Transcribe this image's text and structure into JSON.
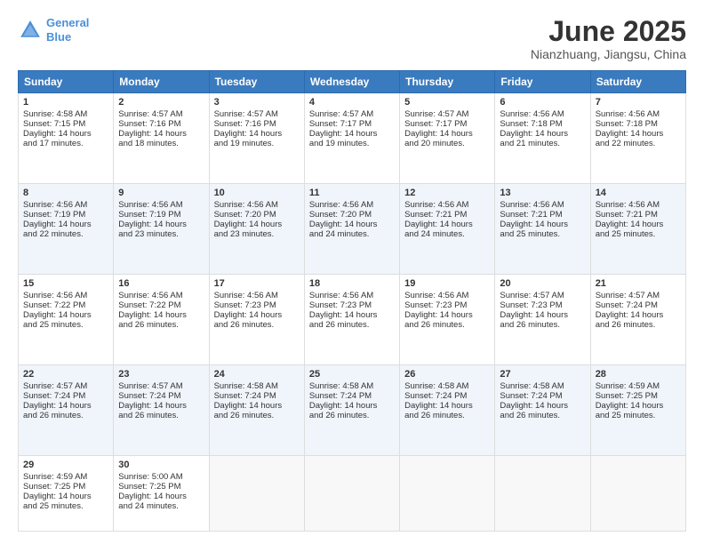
{
  "header": {
    "logo_line1": "General",
    "logo_line2": "Blue",
    "month_title": "June 2025",
    "location": "Nianzhuang, Jiangsu, China"
  },
  "days_of_week": [
    "Sunday",
    "Monday",
    "Tuesday",
    "Wednesday",
    "Thursday",
    "Friday",
    "Saturday"
  ],
  "weeks": [
    [
      {
        "day": "1",
        "info": "Sunrise: 4:58 AM\nSunset: 7:15 PM\nDaylight: 14 hours\nand 17 minutes."
      },
      {
        "day": "2",
        "info": "Sunrise: 4:57 AM\nSunset: 7:16 PM\nDaylight: 14 hours\nand 18 minutes."
      },
      {
        "day": "3",
        "info": "Sunrise: 4:57 AM\nSunset: 7:16 PM\nDaylight: 14 hours\nand 19 minutes."
      },
      {
        "day": "4",
        "info": "Sunrise: 4:57 AM\nSunset: 7:17 PM\nDaylight: 14 hours\nand 19 minutes."
      },
      {
        "day": "5",
        "info": "Sunrise: 4:57 AM\nSunset: 7:17 PM\nDaylight: 14 hours\nand 20 minutes."
      },
      {
        "day": "6",
        "info": "Sunrise: 4:56 AM\nSunset: 7:18 PM\nDaylight: 14 hours\nand 21 minutes."
      },
      {
        "day": "7",
        "info": "Sunrise: 4:56 AM\nSunset: 7:18 PM\nDaylight: 14 hours\nand 22 minutes."
      }
    ],
    [
      {
        "day": "8",
        "info": "Sunrise: 4:56 AM\nSunset: 7:19 PM\nDaylight: 14 hours\nand 22 minutes."
      },
      {
        "day": "9",
        "info": "Sunrise: 4:56 AM\nSunset: 7:19 PM\nDaylight: 14 hours\nand 23 minutes."
      },
      {
        "day": "10",
        "info": "Sunrise: 4:56 AM\nSunset: 7:20 PM\nDaylight: 14 hours\nand 23 minutes."
      },
      {
        "day": "11",
        "info": "Sunrise: 4:56 AM\nSunset: 7:20 PM\nDaylight: 14 hours\nand 24 minutes."
      },
      {
        "day": "12",
        "info": "Sunrise: 4:56 AM\nSunset: 7:21 PM\nDaylight: 14 hours\nand 24 minutes."
      },
      {
        "day": "13",
        "info": "Sunrise: 4:56 AM\nSunset: 7:21 PM\nDaylight: 14 hours\nand 25 minutes."
      },
      {
        "day": "14",
        "info": "Sunrise: 4:56 AM\nSunset: 7:21 PM\nDaylight: 14 hours\nand 25 minutes."
      }
    ],
    [
      {
        "day": "15",
        "info": "Sunrise: 4:56 AM\nSunset: 7:22 PM\nDaylight: 14 hours\nand 25 minutes."
      },
      {
        "day": "16",
        "info": "Sunrise: 4:56 AM\nSunset: 7:22 PM\nDaylight: 14 hours\nand 26 minutes."
      },
      {
        "day": "17",
        "info": "Sunrise: 4:56 AM\nSunset: 7:23 PM\nDaylight: 14 hours\nand 26 minutes."
      },
      {
        "day": "18",
        "info": "Sunrise: 4:56 AM\nSunset: 7:23 PM\nDaylight: 14 hours\nand 26 minutes."
      },
      {
        "day": "19",
        "info": "Sunrise: 4:56 AM\nSunset: 7:23 PM\nDaylight: 14 hours\nand 26 minutes."
      },
      {
        "day": "20",
        "info": "Sunrise: 4:57 AM\nSunset: 7:23 PM\nDaylight: 14 hours\nand 26 minutes."
      },
      {
        "day": "21",
        "info": "Sunrise: 4:57 AM\nSunset: 7:24 PM\nDaylight: 14 hours\nand 26 minutes."
      }
    ],
    [
      {
        "day": "22",
        "info": "Sunrise: 4:57 AM\nSunset: 7:24 PM\nDaylight: 14 hours\nand 26 minutes."
      },
      {
        "day": "23",
        "info": "Sunrise: 4:57 AM\nSunset: 7:24 PM\nDaylight: 14 hours\nand 26 minutes."
      },
      {
        "day": "24",
        "info": "Sunrise: 4:58 AM\nSunset: 7:24 PM\nDaylight: 14 hours\nand 26 minutes."
      },
      {
        "day": "25",
        "info": "Sunrise: 4:58 AM\nSunset: 7:24 PM\nDaylight: 14 hours\nand 26 minutes."
      },
      {
        "day": "26",
        "info": "Sunrise: 4:58 AM\nSunset: 7:24 PM\nDaylight: 14 hours\nand 26 minutes."
      },
      {
        "day": "27",
        "info": "Sunrise: 4:58 AM\nSunset: 7:24 PM\nDaylight: 14 hours\nand 26 minutes."
      },
      {
        "day": "28",
        "info": "Sunrise: 4:59 AM\nSunset: 7:25 PM\nDaylight: 14 hours\nand 25 minutes."
      }
    ],
    [
      {
        "day": "29",
        "info": "Sunrise: 4:59 AM\nSunset: 7:25 PM\nDaylight: 14 hours\nand 25 minutes."
      },
      {
        "day": "30",
        "info": "Sunrise: 5:00 AM\nSunset: 7:25 PM\nDaylight: 14 hours\nand 24 minutes."
      },
      {
        "day": "",
        "info": ""
      },
      {
        "day": "",
        "info": ""
      },
      {
        "day": "",
        "info": ""
      },
      {
        "day": "",
        "info": ""
      },
      {
        "day": "",
        "info": ""
      }
    ]
  ]
}
